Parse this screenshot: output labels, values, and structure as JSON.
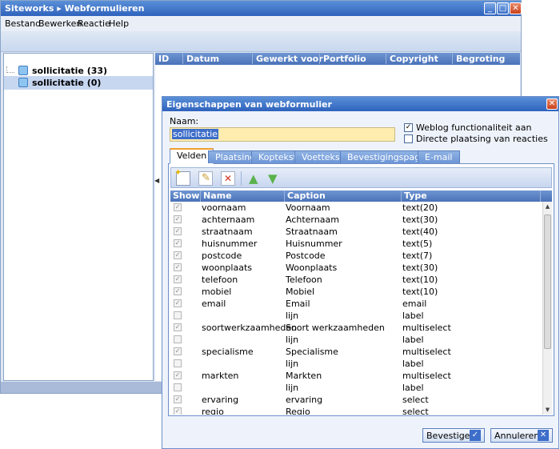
{
  "main_window": {
    "title": "Siteworks ▸ Webformulieren",
    "controls": {
      "minimize": "_",
      "maximize": "□",
      "close": "✕"
    }
  },
  "menu": [
    "Bestand",
    "Bewerken",
    "Reactie",
    "Help"
  ],
  "tree": {
    "items": [
      {
        "label": "sollicitatie (33)"
      },
      {
        "label": "sollicitatie (0)"
      }
    ]
  },
  "grid": {
    "columns": [
      "ID",
      "Datum",
      "Gewerkt voor",
      "Portfolio",
      "Copyright",
      "Begroting"
    ]
  },
  "dialog": {
    "title": "Eigenschappen van webformulier",
    "close": "✕",
    "naam_label": "Naam:",
    "naam_value": "sollicitatie",
    "weblog_label": "Weblog functionaliteit aan",
    "weblog_checked": "✓",
    "direct_label": "Directe plaatsing van reacties",
    "tabs": [
      "Velden",
      "Plaatsing",
      "Koptekst",
      "Voettekst",
      "Bevestigingspagina",
      "E-mail"
    ],
    "active_tab": "Velden",
    "fields_header": [
      "Show",
      "Name",
      "Caption",
      "Type"
    ],
    "rows": [
      {
        "show": "✓",
        "name": "voornaam",
        "caption": "Voornaam",
        "type": "text(20)"
      },
      {
        "show": "✓",
        "name": "achternaam",
        "caption": "Achternaam",
        "type": "text(30)"
      },
      {
        "show": "✓",
        "name": "straatnaam",
        "caption": "Straatnaam",
        "type": "text(40)"
      },
      {
        "show": "✓",
        "name": "huisnummer",
        "caption": "Huisnummer",
        "type": "text(5)"
      },
      {
        "show": "✓",
        "name": "postcode",
        "caption": "Postcode",
        "type": "text(7)"
      },
      {
        "show": "✓",
        "name": "woonplaats",
        "caption": "Woonplaats",
        "type": "text(30)"
      },
      {
        "show": "✓",
        "name": "telefoon",
        "caption": "Telefoon",
        "type": "text(10)"
      },
      {
        "show": "✓",
        "name": "mobiel",
        "caption": "Mobiel",
        "type": "text(10)"
      },
      {
        "show": "✓",
        "name": "email",
        "caption": "Email",
        "type": "email"
      },
      {
        "show": "",
        "name": "",
        "caption": "lijn",
        "type": "label"
      },
      {
        "show": "✓",
        "name": "soortwerkzaamheden",
        "caption": "Soort werkzaamheden",
        "type": "multiselect"
      },
      {
        "show": "",
        "name": "",
        "caption": "lijn",
        "type": "label"
      },
      {
        "show": "✓",
        "name": "specialisme",
        "caption": "Specialisme",
        "type": "multiselect"
      },
      {
        "show": "",
        "name": "",
        "caption": "lijn",
        "type": "label"
      },
      {
        "show": "✓",
        "name": "markten",
        "caption": "Markten",
        "type": "multiselect"
      },
      {
        "show": "",
        "name": "",
        "caption": "lijn",
        "type": "label"
      },
      {
        "show": "✓",
        "name": "ervaring",
        "caption": "ervaring",
        "type": "select"
      },
      {
        "show": "✓",
        "name": "regio",
        "caption": "Regio",
        "type": "select"
      }
    ],
    "buttons": {
      "confirm": "Bevestigen",
      "confirm_icon": "✓",
      "cancel": "Annuleren",
      "cancel_icon": "✕"
    }
  },
  "colors": {
    "titlebar": "#2f63bd",
    "header": "#4a72b8",
    "naam_bg": "#ffedb0",
    "tab_accent": "#f0a030"
  }
}
